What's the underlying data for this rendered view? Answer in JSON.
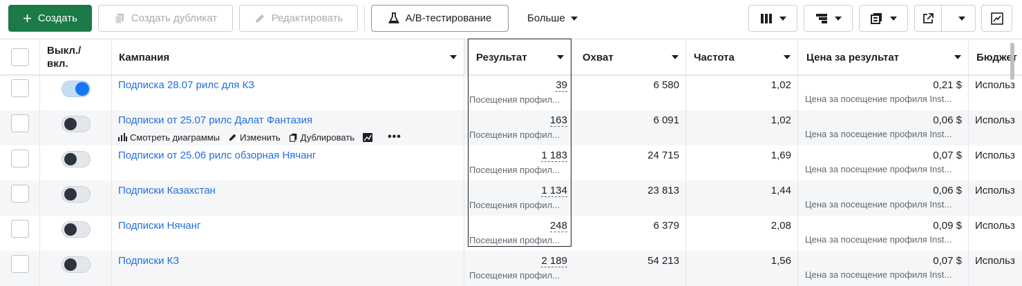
{
  "toolbar": {
    "create_label": "Создать",
    "duplicate_label": "Создать дубликат",
    "edit_label": "Редактировать",
    "ab_label": "A/B-тестирование",
    "more_label": "Больше"
  },
  "header": {
    "toggle": "Выкл./ вкл.",
    "campaign": "Кампания",
    "result": "Результат",
    "reach": "Охват",
    "frequency": "Частота",
    "cost": "Цена за результат",
    "budget": "Бюджет"
  },
  "row_actions": {
    "charts": "Смотреть диаграммы",
    "edit": "Изменить",
    "duplicate": "Дублировать"
  },
  "rows": [
    {
      "name": "Подписка 28.07 рилс для КЗ",
      "on": true,
      "result": "39",
      "result_type": "Посещения профил...",
      "reach": "6 580",
      "frequency": "1,02",
      "cost": "0,21 $",
      "cost_type": "Цена за посещение профиля Inst...",
      "budget": "Использ"
    },
    {
      "name": "Подписки от 25.07 рилс Далат Фантазия",
      "on": false,
      "result": "163",
      "result_type": "Посещения профил...",
      "reach": "6 091",
      "frequency": "1,02",
      "cost": "0,06 $",
      "cost_type": "Цена за посещение профиля Inst...",
      "budget": "Использ"
    },
    {
      "name": "Подписки от 25.06 рилс обзорная Нячанг",
      "on": false,
      "result": "1 183",
      "result_type": "Посещения профил...",
      "reach": "24 715",
      "frequency": "1,69",
      "cost": "0,07 $",
      "cost_type": "Цена за посещение профиля Inst...",
      "budget": "Использ"
    },
    {
      "name": "Подписки Казахстан",
      "on": false,
      "result": "1 134",
      "result_type": "Посещения профил...",
      "reach": "23 813",
      "frequency": "1,44",
      "cost": "0,06 $",
      "cost_type": "Цена за посещение профиля Inst...",
      "budget": "Использ"
    },
    {
      "name": "Подписки Нячанг",
      "on": false,
      "result": "248",
      "result_type": "Посещения профил...",
      "reach": "6 379",
      "frequency": "2,08",
      "cost": "0,09 $",
      "cost_type": "Цена за посещение профиля Inst...",
      "budget": "Использ"
    },
    {
      "name": "Подписки КЗ",
      "on": false,
      "result": "2 189",
      "result_type": "Посещения профил...",
      "reach": "54 213",
      "frequency": "1,56",
      "cost": "0,07 $",
      "cost_type": "Цена за посещение профиля Inst...",
      "budget": "Использ"
    }
  ],
  "colors": {
    "create": "#1b7a47",
    "link": "#216fdb",
    "toggle_on": "#1877f2"
  }
}
